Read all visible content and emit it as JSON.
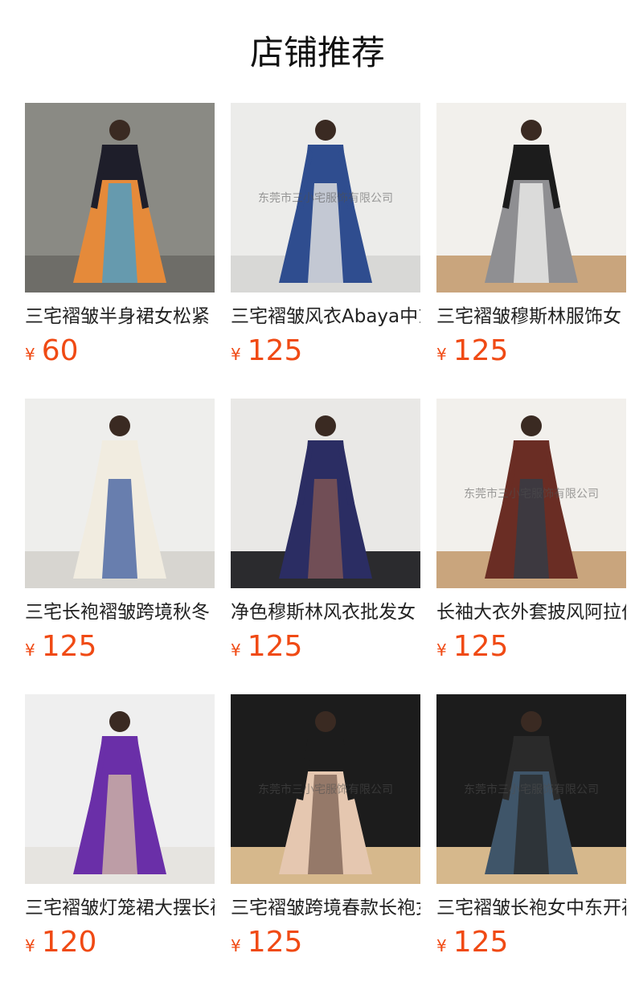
{
  "header": {
    "title": "店铺推荐"
  },
  "colors": {
    "price": "#f04a14",
    "text": "#222222"
  },
  "products": [
    {
      "name": "三宅褶皱半身裙女松紧",
      "currency": "¥",
      "price": "60",
      "watermark": "",
      "image": {
        "bg": "#8a8a84",
        "floor": "#6e6d68",
        "garment": "#e58a3a",
        "accent": "#3b9fd6",
        "top": "#1e1e2a"
      }
    },
    {
      "name": "三宅褶皱风衣Abaya中东",
      "currency": "¥",
      "price": "125",
      "watermark": "东莞市三小宅服饰有限公司",
      "image": {
        "bg": "#ececea",
        "floor": "#d8d8d6",
        "garment": "#2f4d8f",
        "accent": "#f5f2ea",
        "top": "#2f4d8f"
      }
    },
    {
      "name": "三宅褶皱穆斯林服饰女",
      "currency": "¥",
      "price": "125",
      "watermark": "",
      "image": {
        "bg": "#f2f0ec",
        "floor": "#c9a57d",
        "garment": "#8f8f92",
        "accent": "#f4f4f2",
        "top": "#1c1c1c"
      }
    },
    {
      "name": "三宅长袍褶皱跨境秋冬",
      "currency": "¥",
      "price": "125",
      "watermark": "",
      "image": {
        "bg": "#eeeeec",
        "floor": "#d7d5d0",
        "garment": "#f1ece0",
        "accent": "#3a5a9e",
        "top": "#f1ece0"
      }
    },
    {
      "name": "净色穆斯林风衣批发女",
      "currency": "¥",
      "price": "125",
      "watermark": "",
      "image": {
        "bg": "#e9e8e6",
        "floor": "#2b2b2e",
        "garment": "#2b2d63",
        "accent": "#8a5a52",
        "top": "#2b2d63"
      }
    },
    {
      "name": "长袖大衣外套披风阿拉伯",
      "currency": "¥",
      "price": "125",
      "watermark": "东莞市三小宅服饰有限公司",
      "image": {
        "bg": "#f2f0ec",
        "floor": "#c9a57d",
        "garment": "#6a2d24",
        "accent": "#2f3e4a",
        "top": "#6a2d24"
      }
    },
    {
      "name": "三宅褶皱灯笼裙大摆长裙",
      "currency": "¥",
      "price": "120",
      "watermark": "",
      "image": {
        "bg": "#efefef",
        "floor": "#e6e4e0",
        "garment": "#6a2fa8",
        "accent": "#d9c3a5",
        "top": "#6a2fa8"
      }
    },
    {
      "name": "三宅褶皱跨境春款长袍女",
      "currency": "¥",
      "price": "125",
      "watermark": "东莞市三小宅服饰有限公司",
      "image": {
        "bg": "#1c1c1c",
        "floor": "#d6b88c",
        "garment": "#e5c7b0",
        "accent": "#7a5f52",
        "top": "#1c1c1c"
      }
    },
    {
      "name": "三宅褶皱长袍女中东开衫",
      "currency": "¥",
      "price": "125",
      "watermark": "东莞市三小宅服饰有限公司",
      "image": {
        "bg": "#1c1c1c",
        "floor": "#d6b88c",
        "garment": "#3f5569",
        "accent": "#2a2a2a",
        "top": "#2a2a2a"
      }
    }
  ]
}
